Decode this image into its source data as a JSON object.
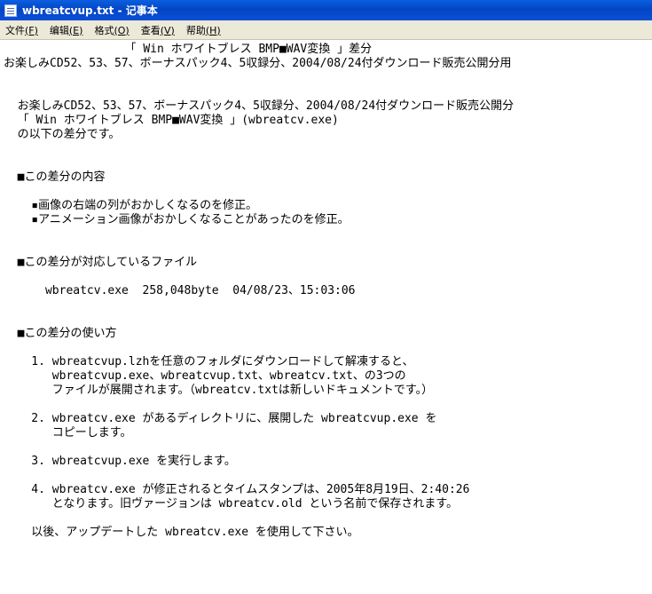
{
  "window": {
    "title": "wbreatcvup.txt - 记事本"
  },
  "menu": [
    {
      "label": "文件",
      "key": "(F)"
    },
    {
      "label": "编辑",
      "key": "(E)"
    },
    {
      "label": "格式",
      "key": "(O)"
    },
    {
      "label": "查看",
      "key": "(V)"
    },
    {
      "label": "帮助",
      "key": "(H)"
    }
  ],
  "document": {
    "lines": [
      "　　　　　　　　　　　「 Win ホワイトブレス BMP■WAV変換 」差分",
      "お楽しみCD52、53、57、ボーナスパック4、5収録分、2004/08/24付ダウンロード販売公開分用",
      "  お楽しみCD52、53、57、ボーナスパック4、5収録分、2004/08/24付ダウンロード販売公開分",
      "  「 Win ホワイトブレス BMP■WAV変換 」(wbreatcv.exe)",
      "  の以下の差分です。",
      "  ■この差分の内容",
      "    ▪画像の右端の列がおかしくなるのを修正。",
      "    ▪アニメーション画像がおかしくなることがあったのを修正。",
      "  ■この差分が対応しているファイル",
      "      wbreatcv.exe  258,048byte  04/08/23、15:03:06",
      "  ■この差分の使い方",
      "    1. wbreatcvup.lzhを任意のフォルダにダウンロードして解凍すると、",
      "       wbreatcvup.exe、wbreatcvup.txt、wbreatcv.txt、の3つの",
      "       ファイルが展開されます。（wbreatcv.txtは新しいドキュメントです。）",
      "    2. wbreatcv.exe があるディレクトリに、展開した wbreatcvup.exe を",
      "       コピーします。",
      "    3. wbreatcvup.exe を実行します。",
      "    4. wbreatcv.exe が修正されるとタイムスタンプは、2005年8月19日、2:40:26",
      "       となります。旧ヴァージョンは wbreatcv.old という名前で保存されます。",
      "    以後、アップデートした wbreatcv.exe を使用して下さい。"
    ]
  }
}
